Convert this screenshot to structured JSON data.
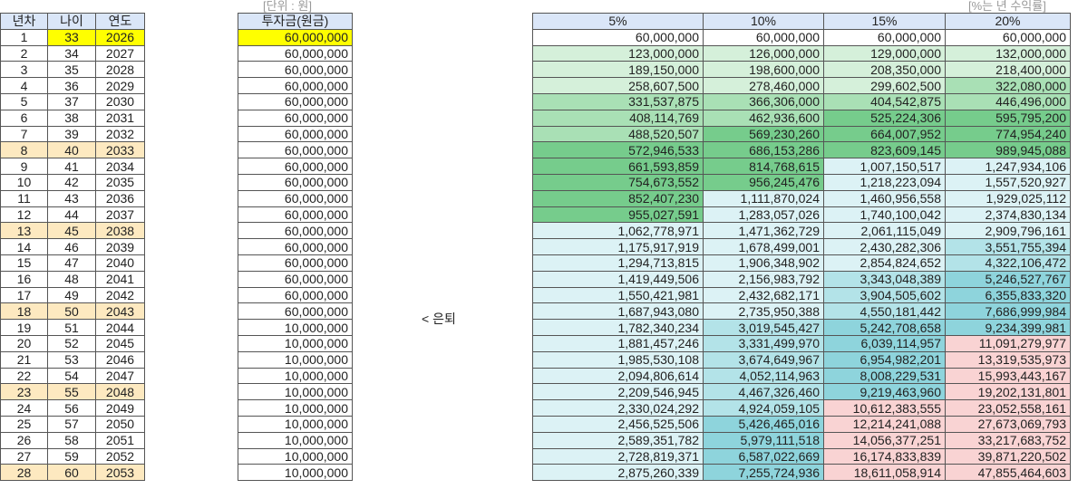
{
  "unit_note": "[단위 : 원]",
  "rate_note": "[%는 년 수익률]",
  "retire_label": "< 은퇴",
  "retire_row": 18,
  "left_headers": [
    "년차",
    "나이",
    "연도"
  ],
  "invest_header": "투자금(원금)",
  "rate_headers": [
    "5%",
    "10%",
    "15%",
    "20%"
  ],
  "colors": {
    "header": "#dae6f8",
    "highlight_yellow": "#ffff00",
    "milestone_orange": "#fde9c0",
    "bands": [
      {
        "min": 0,
        "color": "#ffffff"
      },
      {
        "min": 100000000,
        "color": "#d5f0da"
      },
      {
        "min": 300000000,
        "color": "#a9e0b5"
      },
      {
        "min": 500000000,
        "color": "#76cc8c"
      },
      {
        "min": 1000000000,
        "color": "#dcf2f5"
      },
      {
        "min": 3000000000,
        "color": "#b3e3e8"
      },
      {
        "min": 5000000000,
        "color": "#8ed4dc"
      },
      {
        "min": 10000000000,
        "color": "#f9d3d3"
      }
    ]
  },
  "milestone_years": [
    8,
    13,
    18,
    23,
    28
  ],
  "rows": [
    {
      "year": "1",
      "age": "33",
      "cal": "2026",
      "invest": "60,000,000",
      "vals": [
        "60,000,000",
        "60,000,000",
        "60,000,000",
        "60,000,000"
      ]
    },
    {
      "year": "2",
      "age": "34",
      "cal": "2027",
      "invest": "60,000,000",
      "vals": [
        "123,000,000",
        "126,000,000",
        "129,000,000",
        "132,000,000"
      ]
    },
    {
      "year": "3",
      "age": "35",
      "cal": "2028",
      "invest": "60,000,000",
      "vals": [
        "189,150,000",
        "198,600,000",
        "208,350,000",
        "218,400,000"
      ]
    },
    {
      "year": "4",
      "age": "36",
      "cal": "2029",
      "invest": "60,000,000",
      "vals": [
        "258,607,500",
        "278,460,000",
        "299,602,500",
        "322,080,000"
      ]
    },
    {
      "year": "5",
      "age": "37",
      "cal": "2030",
      "invest": "60,000,000",
      "vals": [
        "331,537,875",
        "366,306,000",
        "404,542,875",
        "446,496,000"
      ]
    },
    {
      "year": "6",
      "age": "38",
      "cal": "2031",
      "invest": "60,000,000",
      "vals": [
        "408,114,769",
        "462,936,600",
        "525,224,306",
        "595,795,200"
      ]
    },
    {
      "year": "7",
      "age": "39",
      "cal": "2032",
      "invest": "60,000,000",
      "vals": [
        "488,520,507",
        "569,230,260",
        "664,007,952",
        "774,954,240"
      ]
    },
    {
      "year": "8",
      "age": "40",
      "cal": "2033",
      "invest": "60,000,000",
      "vals": [
        "572,946,533",
        "686,153,286",
        "823,609,145",
        "989,945,088"
      ]
    },
    {
      "year": "9",
      "age": "41",
      "cal": "2034",
      "invest": "60,000,000",
      "vals": [
        "661,593,859",
        "814,768,615",
        "1,007,150,517",
        "1,247,934,106"
      ]
    },
    {
      "year": "10",
      "age": "42",
      "cal": "2035",
      "invest": "60,000,000",
      "vals": [
        "754,673,552",
        "956,245,476",
        "1,218,223,094",
        "1,557,520,927"
      ]
    },
    {
      "year": "11",
      "age": "43",
      "cal": "2036",
      "invest": "60,000,000",
      "vals": [
        "852,407,230",
        "1,111,870,024",
        "1,460,956,558",
        "1,929,025,112"
      ]
    },
    {
      "year": "12",
      "age": "44",
      "cal": "2037",
      "invest": "60,000,000",
      "vals": [
        "955,027,591",
        "1,283,057,026",
        "1,740,100,042",
        "2,374,830,134"
      ]
    },
    {
      "year": "13",
      "age": "45",
      "cal": "2038",
      "invest": "60,000,000",
      "vals": [
        "1,062,778,971",
        "1,471,362,729",
        "2,061,115,049",
        "2,909,796,161"
      ]
    },
    {
      "year": "14",
      "age": "46",
      "cal": "2039",
      "invest": "60,000,000",
      "vals": [
        "1,175,917,919",
        "1,678,499,001",
        "2,430,282,306",
        "3,551,755,394"
      ]
    },
    {
      "year": "15",
      "age": "47",
      "cal": "2040",
      "invest": "60,000,000",
      "vals": [
        "1,294,713,815",
        "1,906,348,902",
        "2,854,824,652",
        "4,322,106,472"
      ]
    },
    {
      "year": "16",
      "age": "48",
      "cal": "2041",
      "invest": "60,000,000",
      "vals": [
        "1,419,449,506",
        "2,156,983,792",
        "3,343,048,389",
        "5,246,527,767"
      ]
    },
    {
      "year": "17",
      "age": "49",
      "cal": "2042",
      "invest": "60,000,000",
      "vals": [
        "1,550,421,981",
        "2,432,682,171",
        "3,904,505,602",
        "6,355,833,320"
      ]
    },
    {
      "year": "18",
      "age": "50",
      "cal": "2043",
      "invest": "60,000,000",
      "vals": [
        "1,687,943,080",
        "2,735,950,388",
        "4,550,181,442",
        "7,686,999,984"
      ]
    },
    {
      "year": "19",
      "age": "51",
      "cal": "2044",
      "invest": "10,000,000",
      "vals": [
        "1,782,340,234",
        "3,019,545,427",
        "5,242,708,658",
        "9,234,399,981"
      ]
    },
    {
      "year": "20",
      "age": "52",
      "cal": "2045",
      "invest": "10,000,000",
      "vals": [
        "1,881,457,246",
        "3,331,499,970",
        "6,039,114,957",
        "11,091,279,977"
      ]
    },
    {
      "year": "21",
      "age": "53",
      "cal": "2046",
      "invest": "10,000,000",
      "vals": [
        "1,985,530,108",
        "3,674,649,967",
        "6,954,982,201",
        "13,319,535,973"
      ]
    },
    {
      "year": "22",
      "age": "54",
      "cal": "2047",
      "invest": "10,000,000",
      "vals": [
        "2,094,806,614",
        "4,052,114,963",
        "8,008,229,531",
        "15,993,443,167"
      ]
    },
    {
      "year": "23",
      "age": "55",
      "cal": "2048",
      "invest": "10,000,000",
      "vals": [
        "2,209,546,945",
        "4,467,326,460",
        "9,219,463,960",
        "19,202,131,801"
      ]
    },
    {
      "year": "24",
      "age": "56",
      "cal": "2049",
      "invest": "10,000,000",
      "vals": [
        "2,330,024,292",
        "4,924,059,105",
        "10,612,383,555",
        "23,052,558,161"
      ]
    },
    {
      "year": "25",
      "age": "57",
      "cal": "2050",
      "invest": "10,000,000",
      "vals": [
        "2,456,525,506",
        "5,426,465,016",
        "12,214,241,088",
        "27,673,069,793"
      ]
    },
    {
      "year": "26",
      "age": "58",
      "cal": "2051",
      "invest": "10,000,000",
      "vals": [
        "2,589,351,782",
        "5,979,111,518",
        "14,056,377,251",
        "33,217,683,752"
      ]
    },
    {
      "year": "27",
      "age": "59",
      "cal": "2052",
      "invest": "10,000,000",
      "vals": [
        "2,728,819,371",
        "6,587,022,669",
        "16,174,833,839",
        "39,871,220,502"
      ]
    },
    {
      "year": "28",
      "age": "60",
      "cal": "2053",
      "invest": "10,000,000",
      "vals": [
        "2,875,260,339",
        "7,255,724,936",
        "18,611,058,914",
        "47,855,464,603"
      ]
    }
  ]
}
